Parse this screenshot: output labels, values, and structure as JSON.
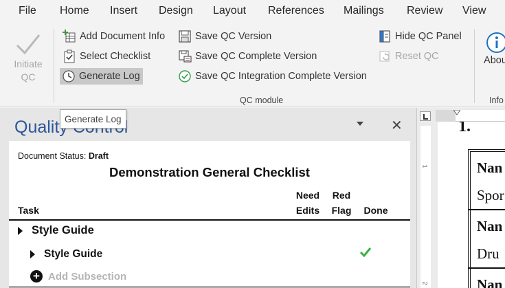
{
  "menu": {
    "file": "File",
    "home": "Home",
    "insert": "Insert",
    "design": "Design",
    "layout": "Layout",
    "references": "References",
    "mailings": "Mailings",
    "review": "Review",
    "view": "View"
  },
  "ribbon": {
    "initiate_qc": "Initiate QC",
    "add_document_info": "Add Document Info",
    "select_checklist": "Select Checklist",
    "generate_log": "Generate Log",
    "save_qc_version": "Save QC Version",
    "save_qc_complete_version": "Save QC Complete Version",
    "save_qc_integration_complete_version": "Save QC Integration Complete Version",
    "hide_qc_panel": "Hide QC Panel",
    "reset_qc": "Reset QC",
    "about": "About",
    "group_qc_module": "QC module",
    "group_info": "Info"
  },
  "tooltip": "Generate Log",
  "pane": {
    "title": "Quality Control",
    "close_glyph": "✕",
    "status_label": "Document Status:",
    "status_value": "Draft",
    "checklist_title": "Demonstration General Checklist",
    "columns": {
      "task": "Task",
      "need_edits_1": "Need",
      "need_edits_2": "Edits",
      "red_flag_1": "Red",
      "red_flag_2": "Flag",
      "done": "Done"
    },
    "rows": [
      {
        "label": "Style Guide",
        "level": 0,
        "done": false
      },
      {
        "label": "Style Guide",
        "level": 1,
        "done": true
      }
    ],
    "add_subsection": "Add Subsection"
  },
  "document": {
    "heading": "1.",
    "cells": [
      "Nan",
      "Spor",
      "Nan",
      "Dru",
      "Nan"
    ],
    "ruler_numbers": [
      "1",
      "2"
    ]
  },
  "colors": {
    "accent_title": "#2b579a",
    "done_check": "#3cb043",
    "info_icon": "#1e73be"
  },
  "icons": {
    "initiate_qc": "checkmark-icon",
    "add_document_info": "add-table-icon",
    "select_checklist": "clipboard-check-icon",
    "generate_log": "clock-icon",
    "save_qc_version": "save-icon",
    "save_qc_complete_version": "save-print-icon",
    "save_qc_integration_complete_version": "check-circle-icon",
    "hide_qc_panel": "panel-icon",
    "reset_qc": "reset-icon",
    "about": "info-icon"
  }
}
